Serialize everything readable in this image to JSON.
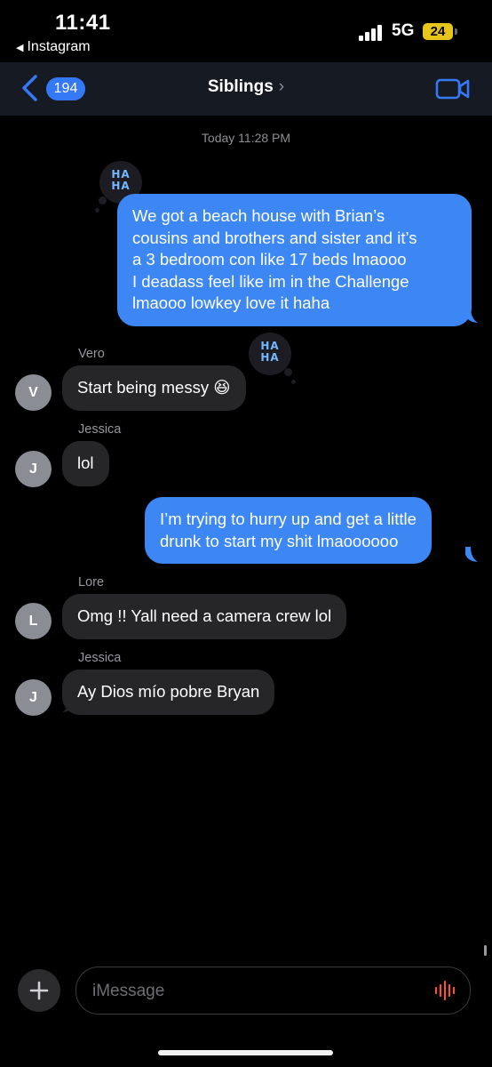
{
  "status_bar": {
    "time": "11:41",
    "back_app": "Instagram",
    "network": "5G",
    "battery": "24"
  },
  "nav": {
    "badge_count": "194",
    "title": "Siblings",
    "title_chevron": "›"
  },
  "chat": {
    "timestamp": "Today 11:28 PM",
    "messages": [
      {
        "direction": "outgoing",
        "lines": [
          "We got a beach house with Brian’s",
          "cousins and brothers and sister and it’s",
          "a 3 bedroom con like 17 beds lmaooo",
          "I deadass feel like im in the Challenge",
          "lmaooo lowkey love it haha"
        ],
        "reaction": "HA HA"
      },
      {
        "direction": "incoming",
        "sender": "Vero",
        "avatar": "V",
        "text": "Start being messy 😆",
        "reaction": "HA HA"
      },
      {
        "direction": "incoming",
        "sender": "Jessica",
        "avatar": "J",
        "text": "lol"
      },
      {
        "direction": "outgoing",
        "lines": [
          "I’m trying to hurry up and get a little",
          "drunk to start my shit lmaoooooo"
        ]
      },
      {
        "direction": "incoming",
        "sender": "Lore",
        "avatar": "L",
        "text": "Omg !! Yall need a camera crew lol"
      },
      {
        "direction": "incoming",
        "sender": "Jessica",
        "avatar": "J",
        "text": "Ay Dios mío pobre Bryan"
      }
    ]
  },
  "reaction_text": {
    "line1": "HA",
    "line2": "HA"
  },
  "composer": {
    "placeholder": "iMessage",
    "value": ""
  },
  "colors": {
    "outgoing_bubble": "#3d87f5",
    "incoming_bubble": "#262628",
    "accent": "#3478f6",
    "mic": "#f0543c",
    "battery": "#e8c51b"
  },
  "icons": [
    "back-triangle-icon",
    "signal-icon",
    "battery-icon",
    "back-chevron-icon",
    "video-camera-icon",
    "haha-tapback-icon",
    "plus-icon",
    "audio-waveform-icon"
  ]
}
